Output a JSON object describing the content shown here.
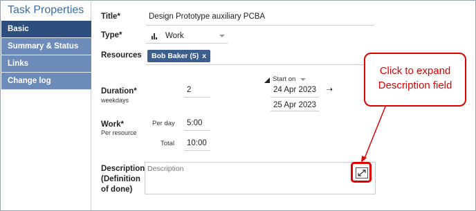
{
  "panel": {
    "title": "Task Properties"
  },
  "nav": {
    "items": [
      {
        "label": "Basic",
        "active": true
      },
      {
        "label": "Summary & Status",
        "active": false
      },
      {
        "label": "Links",
        "active": false
      },
      {
        "label": "Change log",
        "active": false
      }
    ]
  },
  "form": {
    "title_label": "Title*",
    "title_value": "Design Prototype auxiliary PCBA",
    "type_label": "Type*",
    "type_value": "Work",
    "resources_label": "Resources",
    "resource_chip": "Bob Baker (5)",
    "chip_remove": "x",
    "start_on_label": "Start on",
    "duration_label": "Duration*",
    "duration_sub": "weekdays",
    "duration_value": "2",
    "start_date": "24 Apr 2023",
    "end_date": "25 Apr 2023",
    "work_label": "Work*",
    "work_sub": "Per resource",
    "per_day_label": "Per day",
    "per_day_value": "5:00",
    "total_label": "Total",
    "total_value": "10:00",
    "description_label_1": "Description",
    "description_label_2": "(Definition",
    "description_label_3": "of done)",
    "description_placeholder": "Description"
  },
  "annotation": {
    "line1": "Click to expand",
    "line2": "Description field",
    "color": "#e00000"
  },
  "colors": {
    "nav_active": "#2e4f7e",
    "nav_inactive": "#6e8cba",
    "title_blue": "#3d6aa3",
    "chip": "#3d5f8e"
  }
}
